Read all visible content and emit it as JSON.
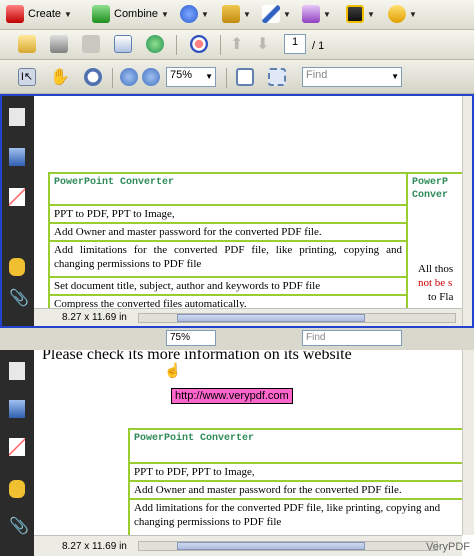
{
  "toolbar1": {
    "create_label": "Create",
    "combine_label": "Combine"
  },
  "toolbar2": {
    "page_number": "1",
    "page_total": "/ 1"
  },
  "toolbar3": {
    "zoom": "75%",
    "find_placeholder": "Find"
  },
  "doc1": {
    "table_header": "PowerPoint Converter",
    "table_header_right": "PowerP Conver",
    "rows": [
      "PPT to PDF, PPT to Image,",
      "Add Owner and master password for the converted PDF file.",
      "Add limitations for the converted PDF file, like printing, copying and changing permissions to PDF file",
      "Set document title, subject, author and keywords to PDF file",
      "Compress the converted files automatically."
    ],
    "right_col_lines": [
      "All thos",
      "not be s",
      "to Fla"
    ],
    "status_size": "8.27 x 11.69 in"
  },
  "doc2": {
    "overlap_zoom": "75%",
    "overlap_find": "Find",
    "headline": "Please check its more information on its website",
    "tooltip": "http://www.verypdf.com",
    "table_header": "PowerPoint Converter",
    "rows": [
      "PPT to PDF, PPT to Image,",
      "Add Owner and master password for the converted PDF file.",
      "Add limitations for the converted PDF file, like printing, copying and changing permissions to PDF file"
    ],
    "status_size": "8.27 x 11.69 in"
  },
  "watermark": "VeryPDF",
  "colors": {
    "table_border": "#9acd32",
    "header_text": "#2e8b57",
    "tooltip_bg": "#ff66cc",
    "highlight_frame": "#2244cc"
  }
}
